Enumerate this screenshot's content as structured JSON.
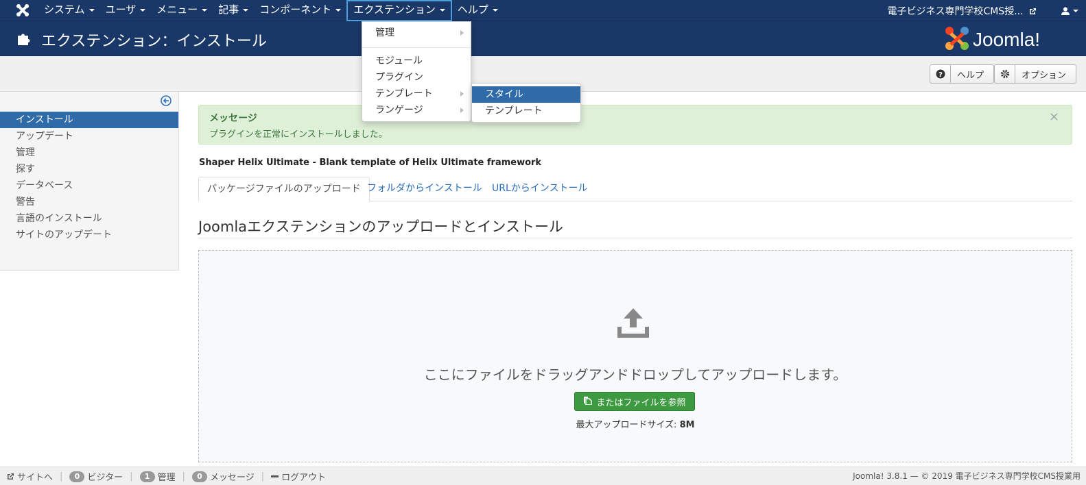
{
  "navbar": {
    "items": [
      {
        "label": "システム"
      },
      {
        "label": "ユーザ"
      },
      {
        "label": "メニュー"
      },
      {
        "label": "記事"
      },
      {
        "label": "コンポーネント"
      },
      {
        "label": "エクステンション"
      },
      {
        "label": "ヘルプ"
      }
    ],
    "site_link": "電子ビジネス専門学校CMS授..."
  },
  "header": {
    "title": "エクステンション：インストール",
    "logo_text": "Joomla!"
  },
  "toolbar": {
    "help_label": "ヘルプ",
    "options_label": "オプション"
  },
  "sidebar": {
    "items": [
      {
        "label": "インストール"
      },
      {
        "label": "アップデート"
      },
      {
        "label": "管理"
      },
      {
        "label": "探す"
      },
      {
        "label": "データベース"
      },
      {
        "label": "警告"
      },
      {
        "label": "言語のインストール"
      },
      {
        "label": "サイトのアップデート"
      }
    ]
  },
  "alert": {
    "title": "メッセージ",
    "message": "プラグインを正常にインストールしました。",
    "close": "×"
  },
  "package_name": "Shaper Helix Ultimate - Blank template of Helix Ultimate framework",
  "tabs": [
    {
      "label": "パッケージファイルのアップロード"
    },
    {
      "label": "フォルダからインストール"
    },
    {
      "label": "URLからインストール"
    }
  ],
  "section_title": "Joomlaエクステンションのアップロードとインストール",
  "dropzone": {
    "text": "ここにファイルをドラッグアンドドロップしてアップロードします。",
    "button_label": "またはファイルを参照",
    "max_label": "最大アップロードサイズ:",
    "max_value": "8M"
  },
  "dropdown": {
    "items": [
      {
        "label": "管理"
      },
      {
        "label": "モジュール"
      },
      {
        "label": "プラグイン"
      },
      {
        "label": "テンプレート"
      },
      {
        "label": "ランゲージ"
      }
    ]
  },
  "submenu": {
    "items": [
      {
        "label": "スタイル"
      },
      {
        "label": "テンプレート"
      }
    ]
  },
  "statusbar": {
    "site_label": "サイトへ",
    "visitors_count": "0",
    "visitors_label": "ビジター",
    "admins_count": "1",
    "admins_label": "管理",
    "messages_count": "0",
    "messages_label": "メッセージ",
    "logout_label": "ログアウト",
    "copyright": "Joomla! 3.8.1 — © 2019 電子ビジネス専門学校CMS授業用"
  },
  "colors": {
    "navbar_bg": "#1a3867",
    "active_blue": "#2f6ba8",
    "success_green": "#3d9a40",
    "alert_bg": "#dff0d8"
  }
}
